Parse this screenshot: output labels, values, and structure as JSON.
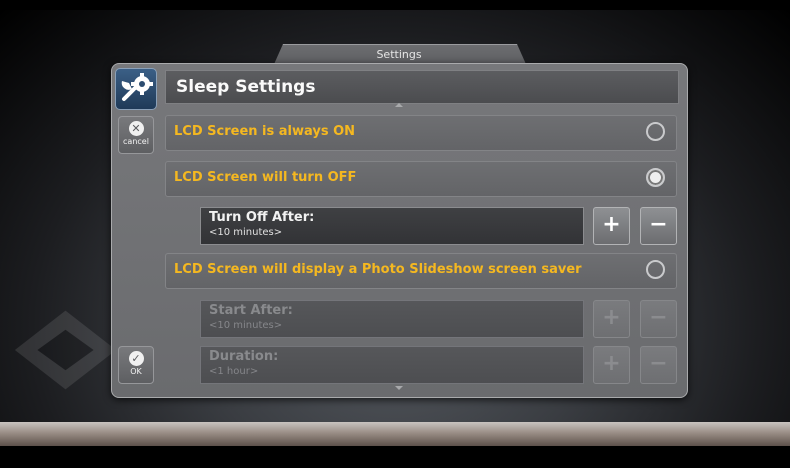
{
  "window": {
    "tab_title": "Settings"
  },
  "header": {
    "title": "Sleep Settings",
    "icon": "settings-tools-icon"
  },
  "side": {
    "cancel": {
      "label": "cancel",
      "icon": "close-icon",
      "glyph": "✕"
    },
    "ok": {
      "label": "OK",
      "icon": "check-icon",
      "glyph": "✓"
    }
  },
  "options": [
    {
      "label": "LCD Screen is always ON",
      "selected": false
    },
    {
      "label": "LCD Screen will turn OFF",
      "selected": true
    },
    {
      "label": "LCD Screen will display a Photo Slideshow screen saver",
      "selected": false
    }
  ],
  "fields": {
    "turn_off_after": {
      "title": "Turn Off After:",
      "value": "<10 minutes>",
      "enabled": true
    },
    "start_after": {
      "title": "Start After:",
      "value": "<10 minutes>",
      "enabled": false
    },
    "duration": {
      "title": "Duration:",
      "value": "<1 hour>",
      "enabled": false
    }
  },
  "stepper": {
    "plus": "+",
    "minus": "−"
  },
  "colors": {
    "option_text": "#f5b820",
    "icon_button": "#2c4c70"
  }
}
